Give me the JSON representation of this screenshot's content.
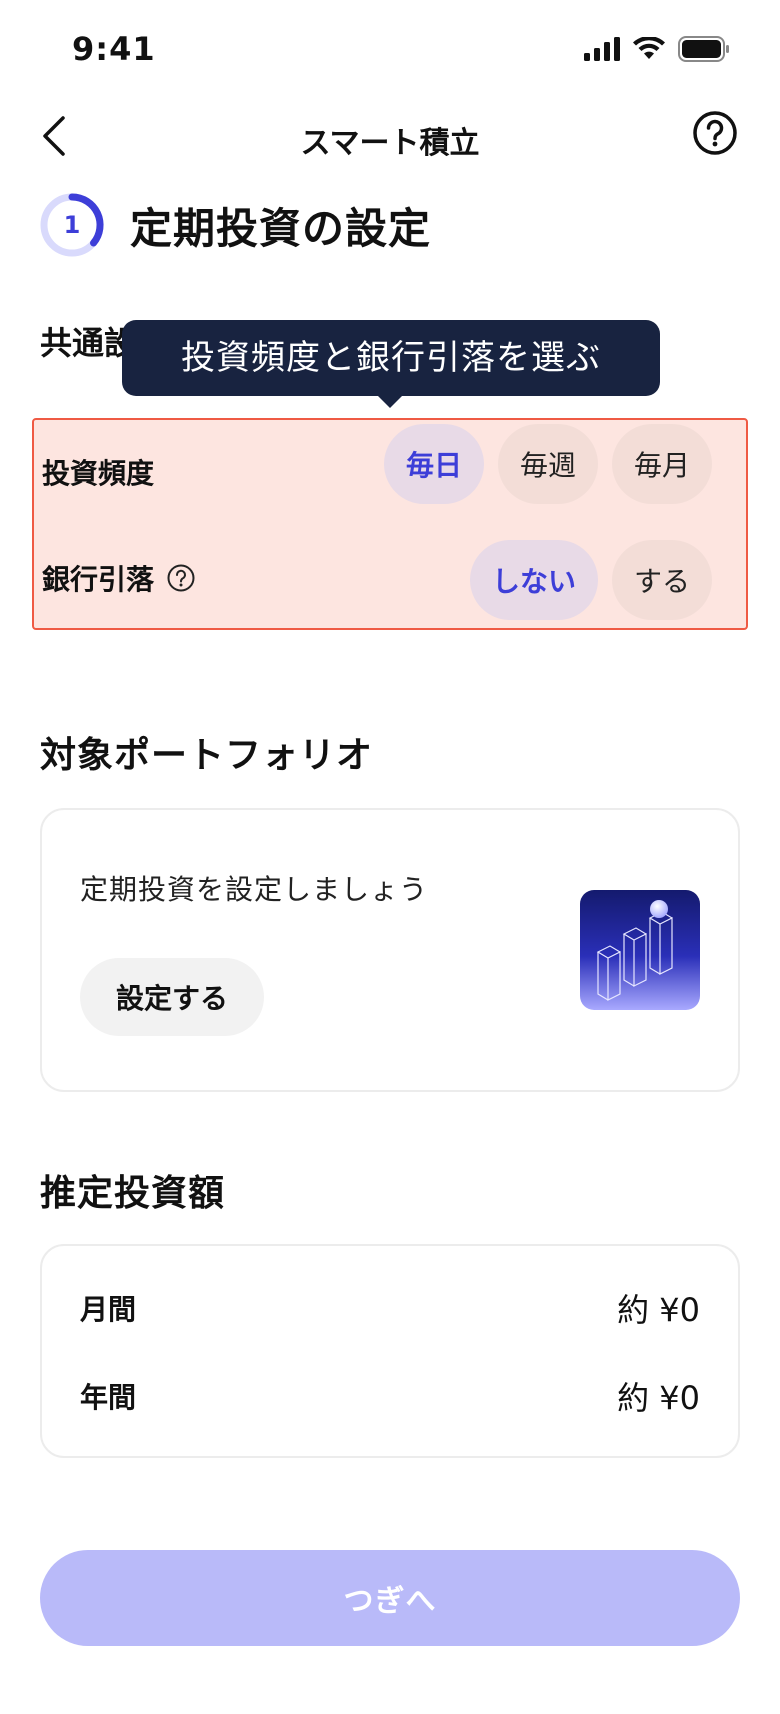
{
  "status_bar": {
    "time": "9:41"
  },
  "nav": {
    "title": "スマート積立"
  },
  "step": {
    "number": "1",
    "title": "定期投資の設定",
    "ring_color": "#3d3ed8",
    "ring_track_color": "#d9dafc"
  },
  "common": {
    "section_title": "共通設定",
    "tooltip": "投資頻度と銀行引落を選ぶ",
    "frequency": {
      "label": "投資頻度",
      "options": [
        "毎日",
        "毎週",
        "毎月"
      ],
      "selected": "毎日"
    },
    "bank_debit": {
      "label": "銀行引落",
      "options": [
        "しない",
        "する"
      ],
      "selected": "しない"
    }
  },
  "portfolio": {
    "section_title": "対象ポートフォリオ",
    "prompt": "定期投資を設定しましょう",
    "button": "設定する",
    "illustration": "bar-chart-3d-illustration"
  },
  "estimate": {
    "section_title": "推定投資額",
    "rows": [
      {
        "label": "月間",
        "value": "約 ¥0"
      },
      {
        "label": "年間",
        "value": "約 ¥0"
      }
    ]
  },
  "next_button": "つぎへ",
  "colors": {
    "accent": "#3d3ed8",
    "highlight_border": "#ef5a44",
    "highlight_fill": "#fde5e0",
    "tooltip_bg": "#182340",
    "disabled_button": "#b9baf9"
  }
}
